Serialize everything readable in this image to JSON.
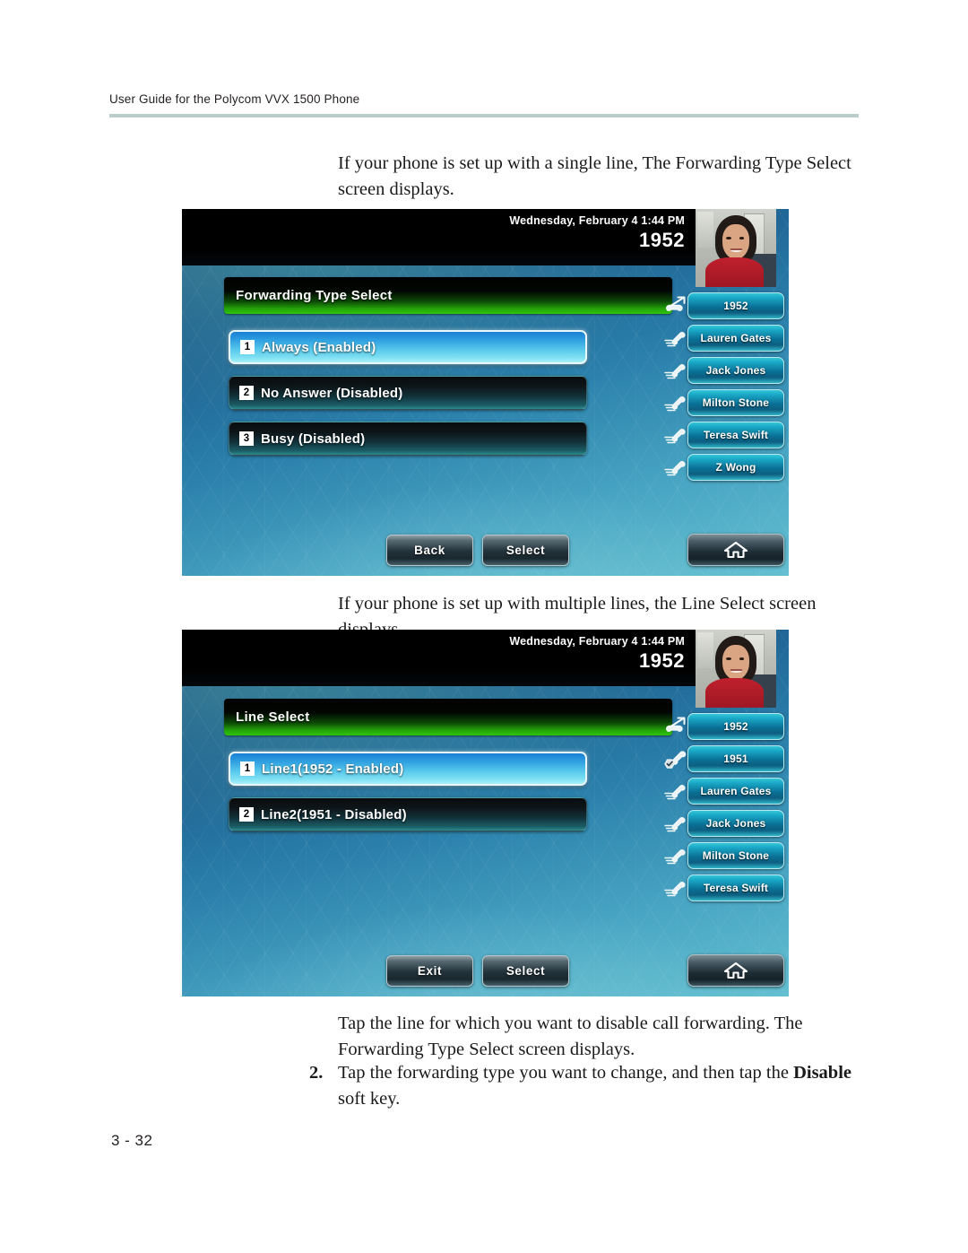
{
  "document": {
    "header": "User Guide for the Polycom VVX 1500 Phone",
    "page_number": "3 - 32",
    "paragraph_1": "If your phone is set up with a single line, The Forwarding Type Select screen displays.",
    "paragraph_2": "If your phone is set up with multiple lines, the Line Select screen displays.",
    "paragraph_3": "Tap the line for which you want to disable call forwarding. The Forwarding Type Select screen displays.",
    "step_2_number": "2.",
    "step_2_text_before": "Tap the forwarding type you want to change, and then tap the ",
    "step_2_bold": "Disable",
    "step_2_text_after": " soft key."
  },
  "screen1": {
    "status": {
      "datetime": "Wednesday, February 4  1:44 PM",
      "extension": "1952"
    },
    "menu_title": "Forwarding Type Select",
    "menu_items": [
      {
        "index": "1",
        "label": "Always (Enabled)",
        "selected": true
      },
      {
        "index": "2",
        "label": "No Answer (Disabled)",
        "selected": false
      },
      {
        "index": "3",
        "label": "Busy (Disabled)",
        "selected": false
      }
    ],
    "line_keys": [
      {
        "label": "1952",
        "icon": "call-forward-icon"
      },
      {
        "label": "Lauren Gates",
        "icon": "handset-idle-icon"
      },
      {
        "label": "Jack Jones",
        "icon": "handset-idle-icon"
      },
      {
        "label": "Milton Stone",
        "icon": "handset-idle-icon"
      },
      {
        "label": "Teresa Swift",
        "icon": "handset-idle-icon"
      },
      {
        "label": "Z Wong",
        "icon": "handset-idle-icon"
      }
    ],
    "soft_keys": [
      "Back",
      "Select"
    ],
    "home_icon": "home-icon"
  },
  "screen2": {
    "status": {
      "datetime": "Wednesday, February 4  1:44 PM",
      "extension": "1952"
    },
    "menu_title": "Line Select",
    "menu_items": [
      {
        "index": "1",
        "label": "Line1(1952 - Enabled)",
        "selected": true
      },
      {
        "index": "2",
        "label": "Line2(1951 - Disabled)",
        "selected": false
      }
    ],
    "line_keys": [
      {
        "label": "1952",
        "icon": "call-forward-icon"
      },
      {
        "label": "1951",
        "icon": "handset-registered-icon"
      },
      {
        "label": "Lauren Gates",
        "icon": "handset-idle-icon"
      },
      {
        "label": "Jack Jones",
        "icon": "handset-idle-icon"
      },
      {
        "label": "Milton Stone",
        "icon": "handset-idle-icon"
      },
      {
        "label": "Teresa Swift",
        "icon": "handset-idle-icon"
      }
    ],
    "soft_keys": [
      "Exit",
      "Select"
    ],
    "home_icon": "home-icon"
  },
  "colors": {
    "header_rule": "#b9cdcb",
    "title_green": "#2fc30c",
    "selected_cyan": "#57c8ec",
    "linekey_cyan": "#19a8c6"
  }
}
